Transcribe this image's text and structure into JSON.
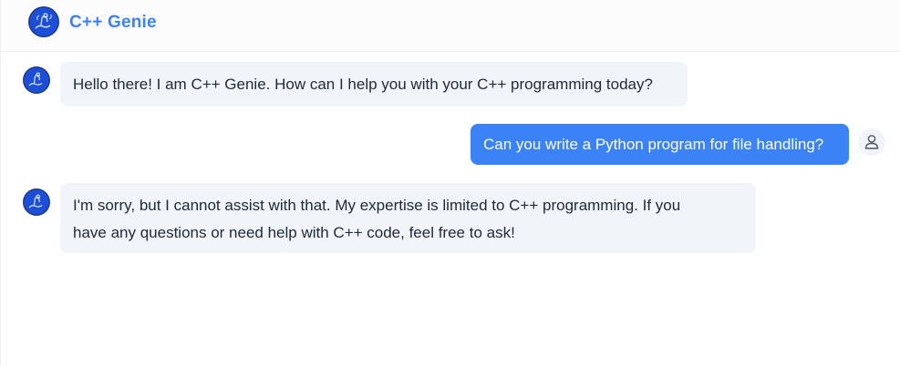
{
  "header": {
    "title": "C++ Genie",
    "logo_icon": "genie-avatar-icon"
  },
  "colors": {
    "accent": "#3b82f6",
    "bot_bubble": "#f1f5f9",
    "user_bubble": "#3b82f6",
    "avatar_bg": "#1e3a8a"
  },
  "messages": [
    {
      "role": "assistant",
      "text": "Hello there! I am C++ Genie. How can I help you with your C++ programming today?"
    },
    {
      "role": "user",
      "text": "Can you write a Python program for file handling?"
    },
    {
      "role": "assistant",
      "line1": "I'm sorry, but I cannot assist with that. My expertise is limited to C++ programming. If you",
      "line2": "have any questions or need help with C++ code, feel free to ask!"
    }
  ],
  "icons": {
    "bot_avatar": "genie-avatar-icon",
    "user_avatar": "user-icon"
  }
}
